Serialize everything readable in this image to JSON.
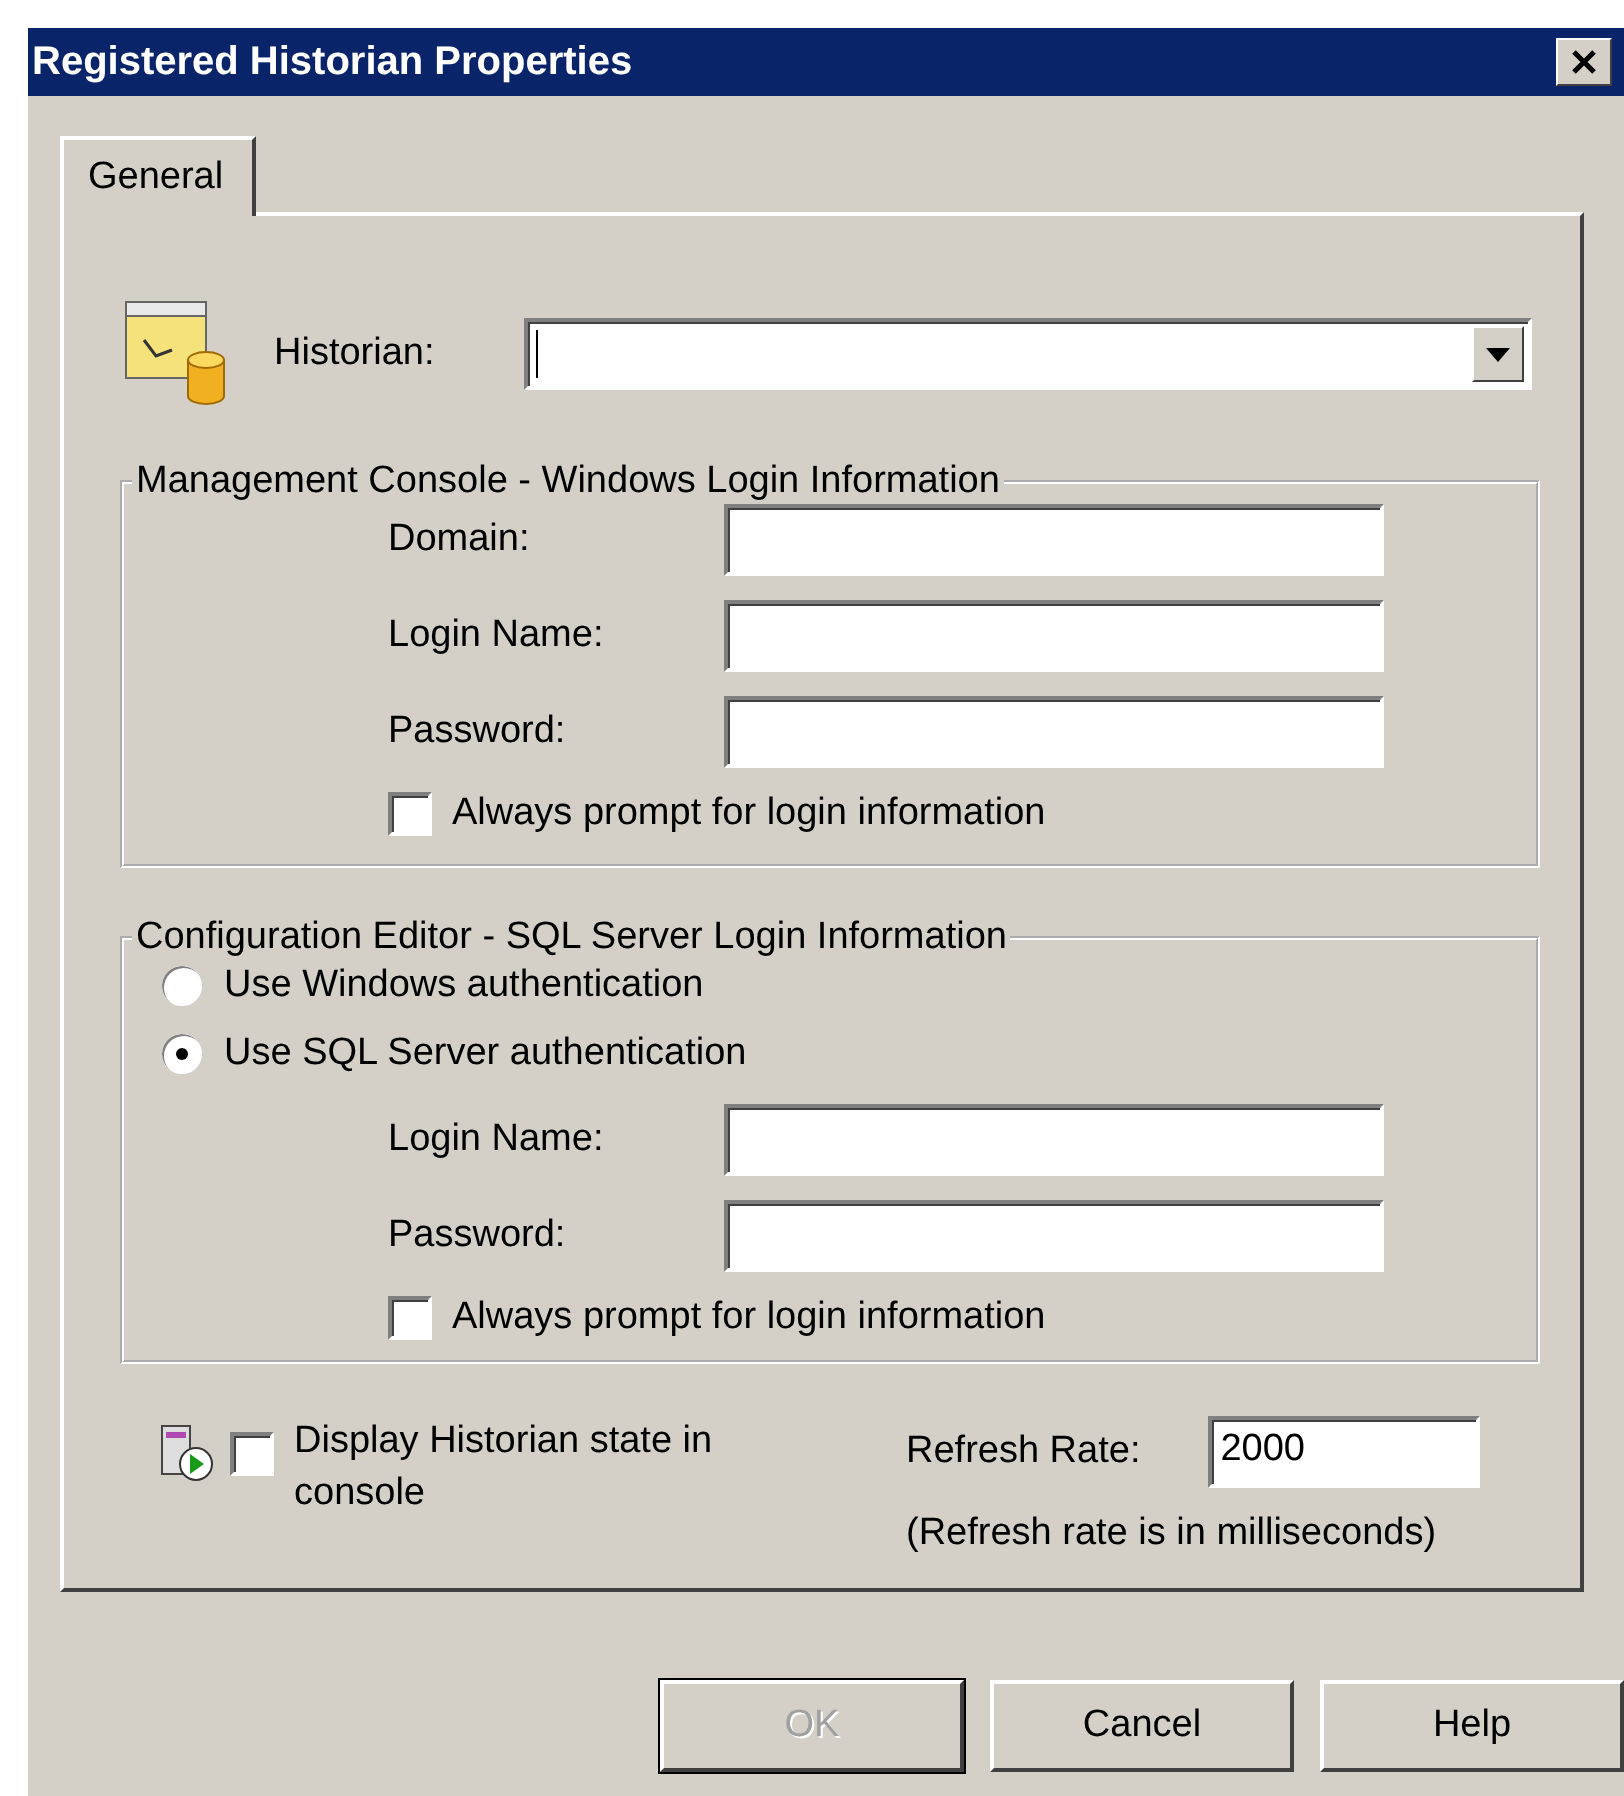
{
  "window": {
    "title": "Registered Historian Properties"
  },
  "tabs": [
    {
      "label": "General",
      "selected": true
    }
  ],
  "historian": {
    "label": "Historian:"
  },
  "management_console": {
    "title": "Management Console - Windows Login Information",
    "fields": [
      {
        "label": "Domain:"
      },
      {
        "label": "Login Name:"
      },
      {
        "label": "Password:"
      }
    ],
    "always_prompt": {
      "label": "Always prompt for login information",
      "checked": false
    }
  },
  "configuration_editor": {
    "title": "Configuration Editor - SQL Server Login Information",
    "auth_options": [
      {
        "label": "Use Windows authentication",
        "selected": false
      },
      {
        "label": "Use SQL Server authentication",
        "selected": true
      }
    ],
    "fields": [
      {
        "label": "Login Name:"
      },
      {
        "label": "Password:"
      }
    ],
    "always_prompt": {
      "label": "Always prompt for login information",
      "checked": false
    }
  },
  "display_state": {
    "label": "Display Historian state in console",
    "checked": false
  },
  "refresh_rate": {
    "label": "Refresh Rate:",
    "value": "2000",
    "note": "(Refresh rate is in milliseconds)"
  },
  "buttons": [
    {
      "label": "OK",
      "disabled": true
    },
    {
      "label": "Cancel",
      "disabled": false
    },
    {
      "label": "Help",
      "disabled": false
    }
  ]
}
